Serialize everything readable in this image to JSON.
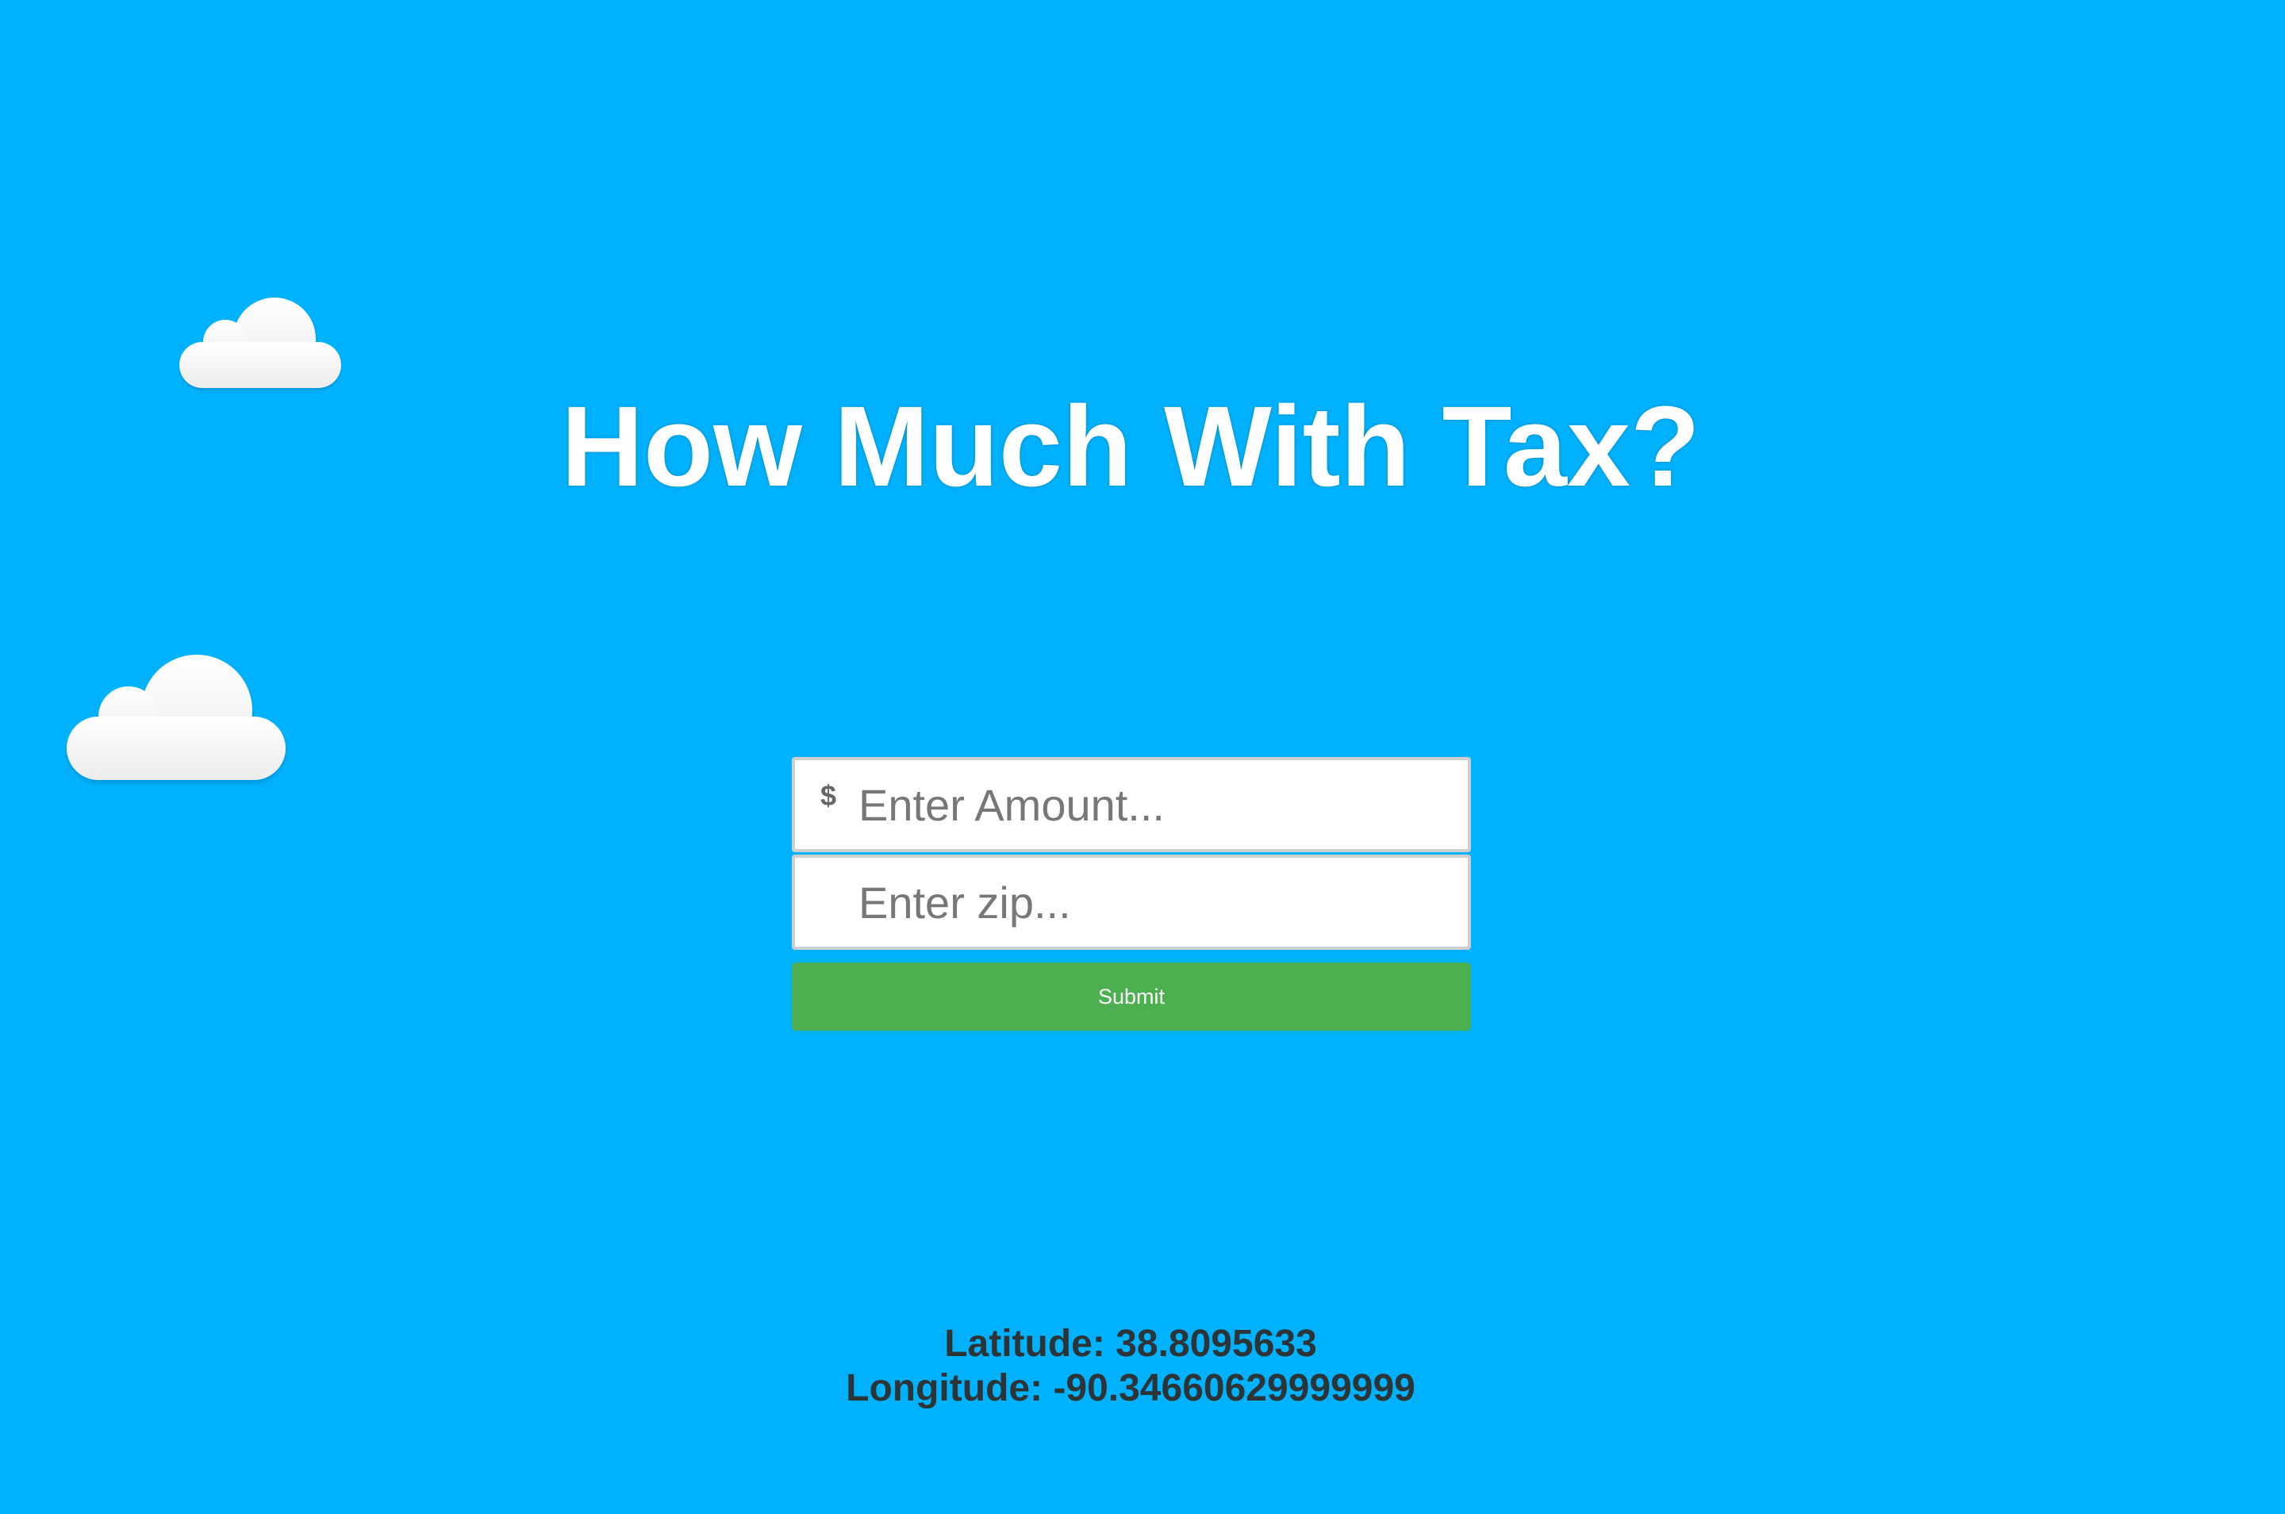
{
  "title": "How Much With Tax?",
  "form": {
    "amount_prefix": "$",
    "amount_placeholder": "Enter Amount...",
    "zip_placeholder": "Enter zip...",
    "submit_label": "Submit"
  },
  "location": {
    "latitude_text": "Latitude: 38.8095633",
    "longitude_text": "Longitude: -90.34660629999999"
  },
  "colors": {
    "background": "#00b2fe",
    "submit_button": "#4caf50",
    "title": "#ffffff",
    "coords_text": "#2d3436"
  },
  "icons": [
    "cloud-icon",
    "cloud-icon"
  ]
}
